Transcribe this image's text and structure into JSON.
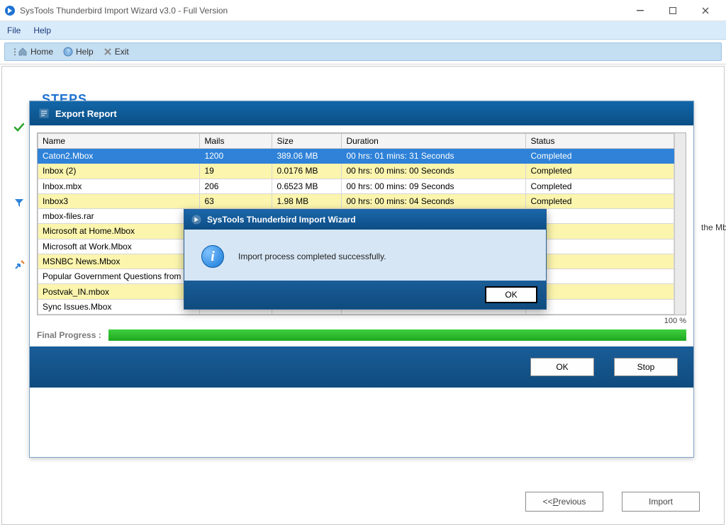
{
  "window": {
    "title": "SysTools Thunderbird Import Wizard v3.0 - Full Version"
  },
  "menubar": {
    "file": "File",
    "help": "Help"
  },
  "toolbar": {
    "home": "Home",
    "help": "Help",
    "exit": "Exit"
  },
  "steps_heading": "STEPS",
  "side_hint": "the Mbox",
  "report": {
    "title": "Export Report",
    "columns": {
      "name": "Name",
      "mails": "Mails",
      "size": "Size",
      "duration": "Duration",
      "status": "Status"
    },
    "rows": [
      {
        "name": "Caton2.Mbox",
        "mails": "1200",
        "size": "389.06 MB",
        "duration": "00 hrs: 01 mins: 31 Seconds",
        "status": "Completed",
        "sel": true
      },
      {
        "name": "Inbox (2)",
        "mails": "19",
        "size": "0.0176 MB",
        "duration": "00 hrs: 00 mins: 00 Seconds",
        "status": "Completed"
      },
      {
        "name": "Inbox.mbx",
        "mails": "206",
        "size": "0.6523 MB",
        "duration": "00 hrs: 00 mins: 09 Seconds",
        "status": "Completed"
      },
      {
        "name": "Inbox3",
        "mails": "63",
        "size": "1.98 MB",
        "duration": "00 hrs: 00 mins: 04 Seconds",
        "status": "Completed"
      },
      {
        "name": "mbox-files.rar",
        "mails": "",
        "size": "",
        "duration": "",
        "status": "eted"
      },
      {
        "name": "Microsoft at Home.Mbox",
        "mails": "",
        "size": "",
        "duration": "",
        "status": "eted"
      },
      {
        "name": "Microsoft at Work.Mbox",
        "mails": "",
        "size": "",
        "duration": "",
        "status": "eted"
      },
      {
        "name": "MSNBC News.Mbox",
        "mails": "",
        "size": "",
        "duration": "",
        "status": "eted"
      },
      {
        "name": "Popular Government Questions from US",
        "mails": "",
        "size": "",
        "duration": "",
        "status": "eted"
      },
      {
        "name": "Postvak_IN.mbox",
        "mails": "",
        "size": "",
        "duration": "",
        "status": "eted"
      },
      {
        "name": "Sync Issues.Mbox",
        "mails": "",
        "size": "",
        "duration": "",
        "status": ""
      }
    ],
    "progress_label": "Final Progress :",
    "progress_pct": "100 %",
    "ok": "OK",
    "stop": "Stop"
  },
  "dialog": {
    "title": "SysTools Thunderbird Import Wizard",
    "message": "Import process completed successfully.",
    "ok": "OK"
  },
  "nav": {
    "previous": "<<Previous",
    "import": "Import"
  },
  "colors": {
    "accent": "#1266a8",
    "row_alt": "#fbf5ae",
    "row_sel": "#2f82d8"
  }
}
